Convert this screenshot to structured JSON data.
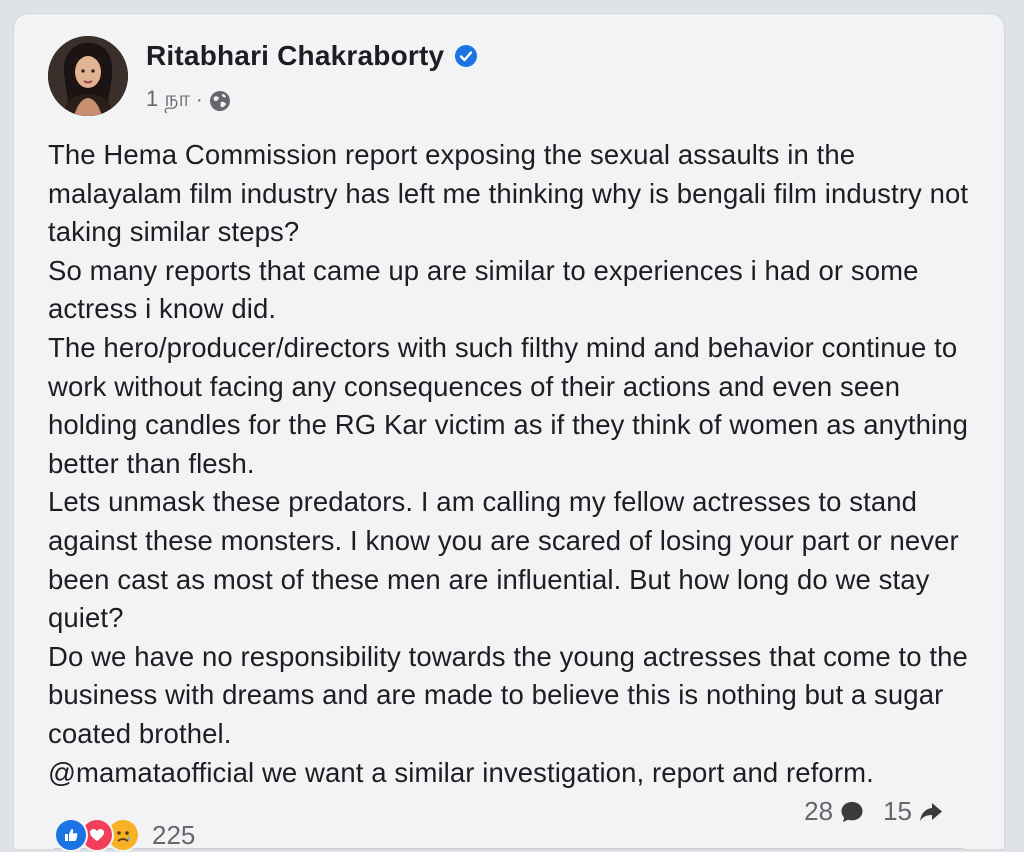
{
  "post": {
    "author": "Ritabhari Chakraborty",
    "verified": true,
    "time": "1 நா",
    "separator": "·",
    "privacy_icon": "globe-icon",
    "paragraphs": [
      "The Hema Commission report exposing the sexual assaults in the malayalam film industry has left me thinking why is bengali film industry not taking similar steps?",
      "So many reports that came up are similar to experiences i had or some actress i know did.",
      "The hero/producer/directors with such filthy mind and behavior continue to work without facing any consequences of their actions and even seen holding candles for the RG Kar victim as if they think of women as anything better than flesh.",
      "Lets unmask these predators. I am calling my fellow actresses to stand against these monsters. I know you are scared of losing your part or never been cast as most of these men are influential. But how long do we stay quiet?",
      "Do we have no responsibility towards the young actresses that come to the business with dreams and are made to believe this is nothing but a sugar coated brothel.",
      "@mamataofficial we want a similar investigation, report and reform."
    ]
  },
  "footer": {
    "reactions": [
      "like-icon",
      "love-icon",
      "sad-icon"
    ],
    "reaction_count": "225",
    "comment_count": "28",
    "share_count": "15"
  },
  "colors": {
    "background": "#dfe2e6",
    "card": "#f2f3f5",
    "text": "#1c1e21",
    "secondary_text": "#65676b",
    "facebook_blue": "#1b74e4",
    "love_red": "#f33e58",
    "sad_yellow": "#f7b125"
  }
}
